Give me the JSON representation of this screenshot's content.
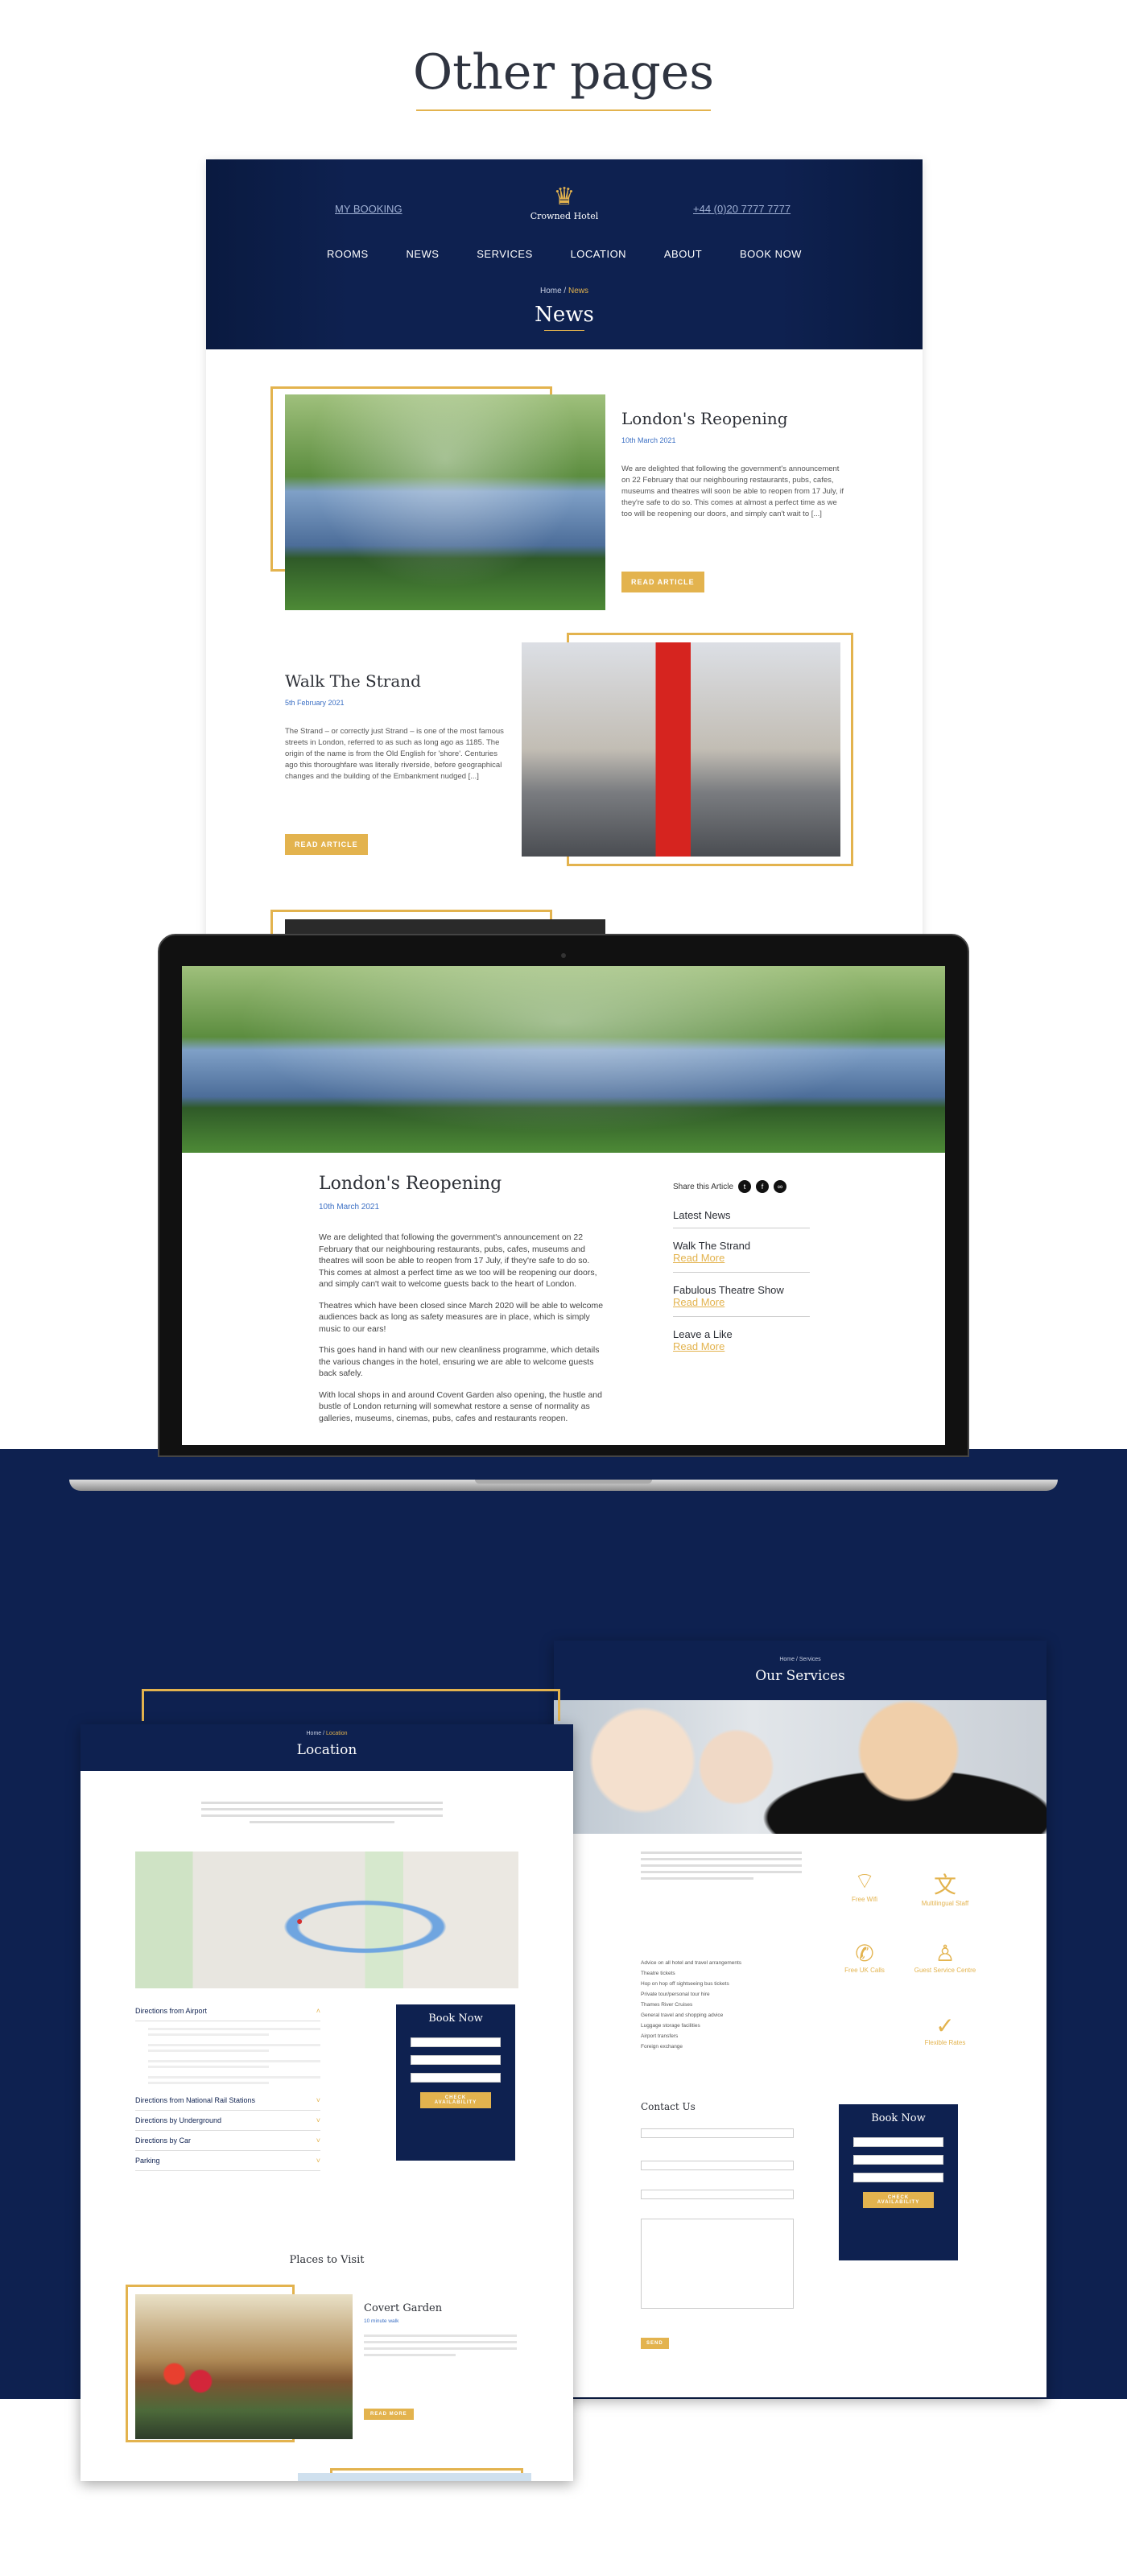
{
  "title": "Other pages",
  "news_page": {
    "header": {
      "my_booking": "MY BOOKING",
      "logo_text": "Crowned Hotel",
      "phone": "+44 (0)20 7777 7777",
      "nav": [
        "ROOMS",
        "NEWS",
        "SERVICES",
        "LOCATION",
        "ABOUT",
        "BOOK NOW"
      ],
      "breadcrumb_home": "Home",
      "breadcrumb_sep": " / ",
      "breadcrumb_current": "News",
      "page_title": "News"
    },
    "articles": [
      {
        "title": "London's Reopening",
        "date": "10th March 2021",
        "excerpt": "We are delighted that following the government's announcement on 22 February that our neighbouring restaurants, pubs, cafes, museums and theatres will soon be able to reopen from 17 July, if they're safe to do so. This comes at almost a perfect time as we too will be reopening our doors, and simply can't wait to [...]",
        "button": "READ ARTICLE"
      },
      {
        "title": "Walk The Strand",
        "date": "5th February 2021",
        "excerpt": "The Strand – or correctly just Strand – is one of the most famous streets in London, referred to as such as long ago as 1185. The origin of the name is from the Old English for 'shore'. Centuries ago this thoroughfare was literally riverside, before geographical changes and the building of the Embankment nudged [...]",
        "button": "READ ARTICLE"
      }
    ]
  },
  "article_page": {
    "title": "London's Reopening",
    "date": "10th March 2021",
    "paragraphs": [
      "We are delighted that following the government's announcement on 22 February that our neighbouring restaurants, pubs, cafes, museums and theatres will soon be able to reopen from 17 July, if they're safe to do so. This comes at almost a perfect time as we too will be reopening our doors, and simply can't wait to welcome guests back to the heart of London.",
      "Theatres which have been closed since March 2020 will be able to welcome audiences back as long as safety measures are in place, which is simply music to our ears!",
      "This goes hand in hand with our new cleanliness programme, which details the various changes in the hotel, ensuring we are able to welcome guests back safely.",
      "With local shops in and around Covent Garden also opening, the hustle and bustle of London returning will somewhat restore a sense of normality as galleries, museums, cinemas, pubs, cafes and restaurants reopen."
    ],
    "share_label": "Share this Article",
    "latest_news_heading": "Latest News",
    "latest": [
      {
        "title": "Walk The Strand",
        "link": "Read More"
      },
      {
        "title": "Fabulous Theatre Show",
        "link": "Read More"
      },
      {
        "title": "Leave a Like",
        "link": "Read More"
      }
    ]
  },
  "location_page": {
    "breadcrumb_home": "Home",
    "breadcrumb_sep": " / ",
    "breadcrumb_current": "Location",
    "title": "Location",
    "accordion": [
      "Directions from Airport",
      "Directions from National Rail Stations",
      "Directions by Underground",
      "Directions by Car",
      "Parking"
    ],
    "book_now": {
      "title": "Book Now",
      "button": "CHECK AVAILABILITY"
    },
    "places_heading": "Places to Visit",
    "place": {
      "title": "Covert Garden",
      "subtitle": "10 minute walk",
      "button": "READ MORE"
    }
  },
  "services_page": {
    "breadcrumb_home": "Home",
    "breadcrumb_sep": " / ",
    "breadcrumb_mid": "Services",
    "title": "Our Services",
    "services": [
      {
        "label": "Free Wifi",
        "icon": "wifi-icon"
      },
      {
        "label": "Multilingual Staff",
        "icon": "language-icon"
      },
      {
        "label": "Free UK Calls",
        "icon": "phone-icon"
      },
      {
        "label": "Guest Service Centre",
        "icon": "concierge-icon"
      },
      {
        "label": "Flexible Rates",
        "icon": "check-circle-icon"
      }
    ],
    "list": [
      "Advice on all hotel and travel arrangements",
      "Theatre tickets",
      "Hop on hop off sightseeing bus tickets",
      "Private tour/personal tour hire",
      "Thames River Cruises",
      "General travel and shopping advice",
      "Luggage storage facilities",
      "Airport transfers",
      "Foreign exchange"
    ],
    "contact": {
      "heading": "Contact Us",
      "button": "SEND"
    },
    "book_now": {
      "title": "Book Now",
      "button": "CHECK AVAILABILITY"
    }
  },
  "colors": {
    "navy": "#0e2150",
    "gold": "#e3b34e"
  }
}
